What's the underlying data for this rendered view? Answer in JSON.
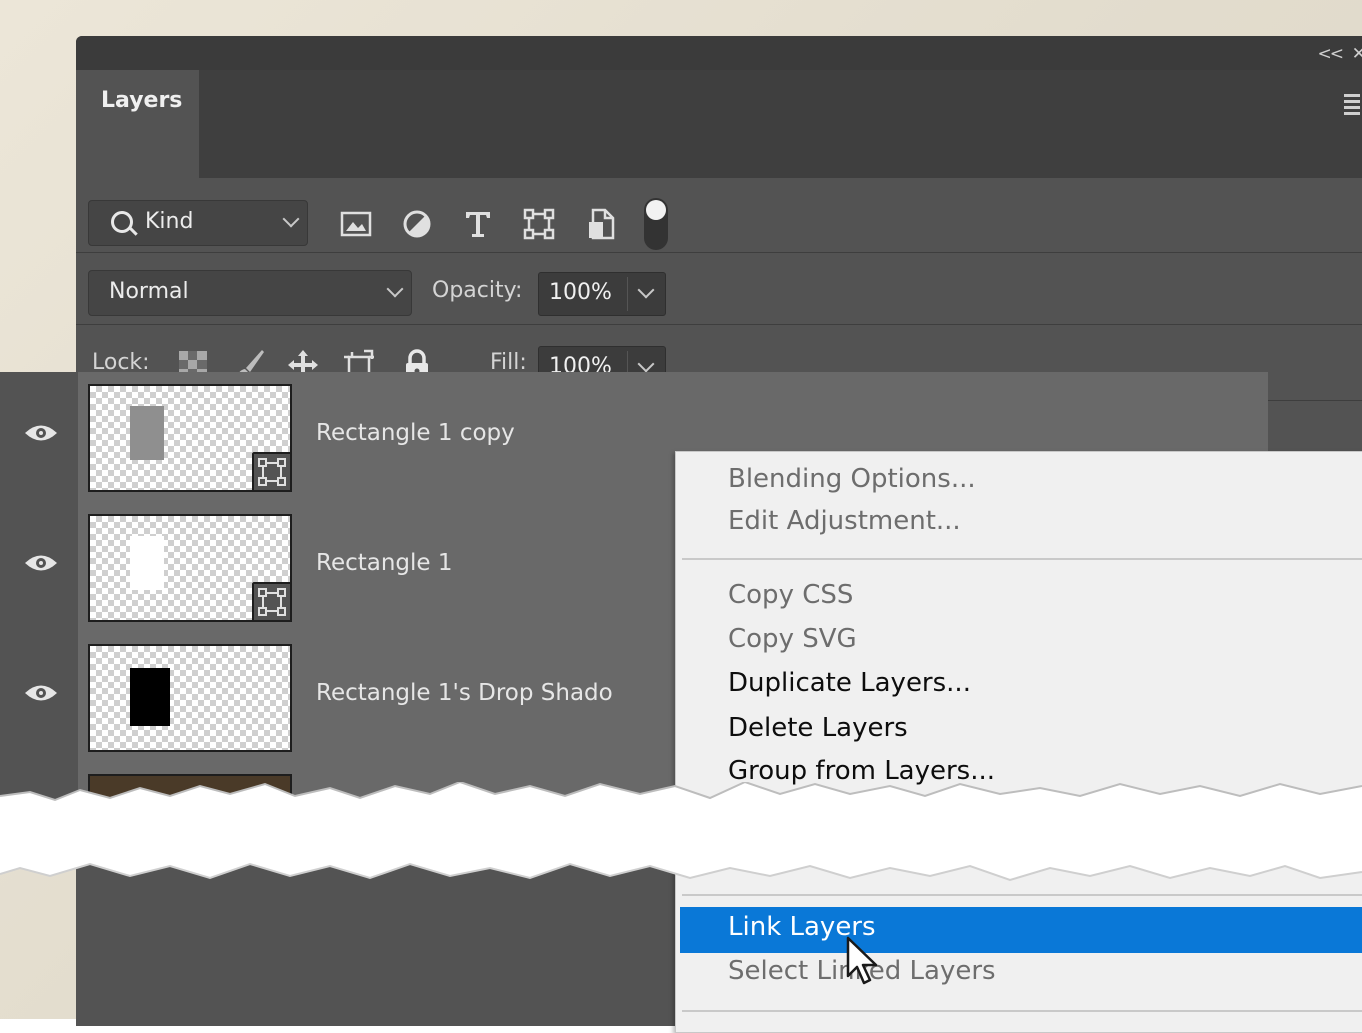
{
  "panel": {
    "tab_label": "Layers",
    "collapse_label": "<<"
  },
  "filter": {
    "kind_label": "Kind",
    "icons": [
      "image-filter-icon",
      "adjustment-filter-icon",
      "type-filter-icon",
      "shape-filter-icon",
      "smart-object-filter-icon",
      "filter-toggle"
    ]
  },
  "blend": {
    "mode": "Normal",
    "opacity_label": "Opacity:",
    "opacity_value": "100%"
  },
  "lock": {
    "label": "Lock:",
    "icons": [
      "lock-transparent-pixels-icon",
      "lock-image-pixels-icon",
      "lock-position-icon",
      "lock-artboard-icon",
      "lock-all-icon"
    ],
    "fill_label": "Fill:",
    "fill_value": "100%"
  },
  "layers": [
    {
      "name": "Rectangle 1 copy",
      "thumb_color": "#8f8f8f",
      "has_shape_badge": true
    },
    {
      "name": "Rectangle 1",
      "thumb_color": "#ffffff",
      "has_shape_badge": true
    },
    {
      "name": "Rectangle 1's Drop Shado",
      "thumb_color": "#000000",
      "has_shape_badge": false
    }
  ],
  "context_menu": {
    "items": [
      {
        "label": "Blending Options...",
        "enabled": false
      },
      {
        "label": "Edit Adjustment...",
        "enabled": false
      },
      {
        "label": "Copy CSS",
        "enabled": false
      },
      {
        "label": "Copy SVG",
        "enabled": false
      },
      {
        "label": "Duplicate Layers...",
        "enabled": true
      },
      {
        "label": "Delete Layers",
        "enabled": true
      },
      {
        "label": "Group from Layers...",
        "enabled": true
      },
      {
        "label": "Link Layers",
        "enabled": true,
        "highlighted": true
      },
      {
        "label": "Select Linked Layers",
        "enabled": false
      }
    ],
    "highlight_color": "#0a78d7"
  }
}
